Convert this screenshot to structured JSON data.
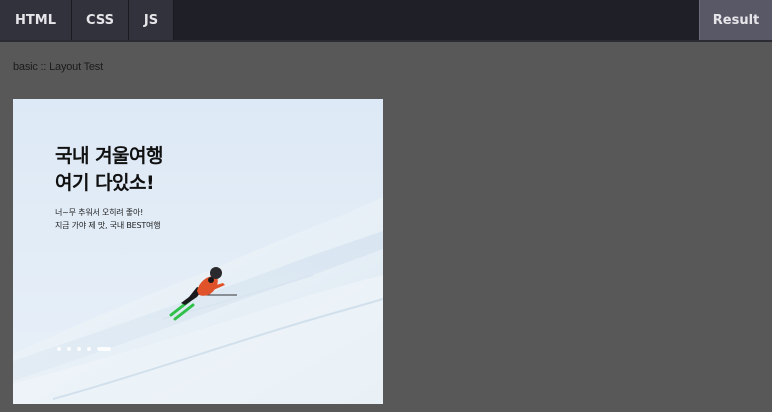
{
  "toolbar": {
    "tabs": {
      "html": "HTML",
      "css": "CSS",
      "js": "JS",
      "result": "Result"
    }
  },
  "page": {
    "label": "basic :: Layout Test"
  },
  "banner": {
    "headline_line1": "국내 겨울여행",
    "headline_line2": "여기 다있소!",
    "subcopy_line1": "너~무 추워서 오히려 좋아!",
    "subcopy_line2": "지금 가야 제 맛, 국내 BEST여행",
    "slide_count": 5,
    "active_slide": 5
  },
  "colors": {
    "toolbar_bg": "#1f1f27",
    "tab_bg": "#32323c",
    "result_tab_bg": "#585866",
    "page_bg": "#585858",
    "skier_jacket": "#e0522a",
    "ski_color": "#2fc04a"
  }
}
